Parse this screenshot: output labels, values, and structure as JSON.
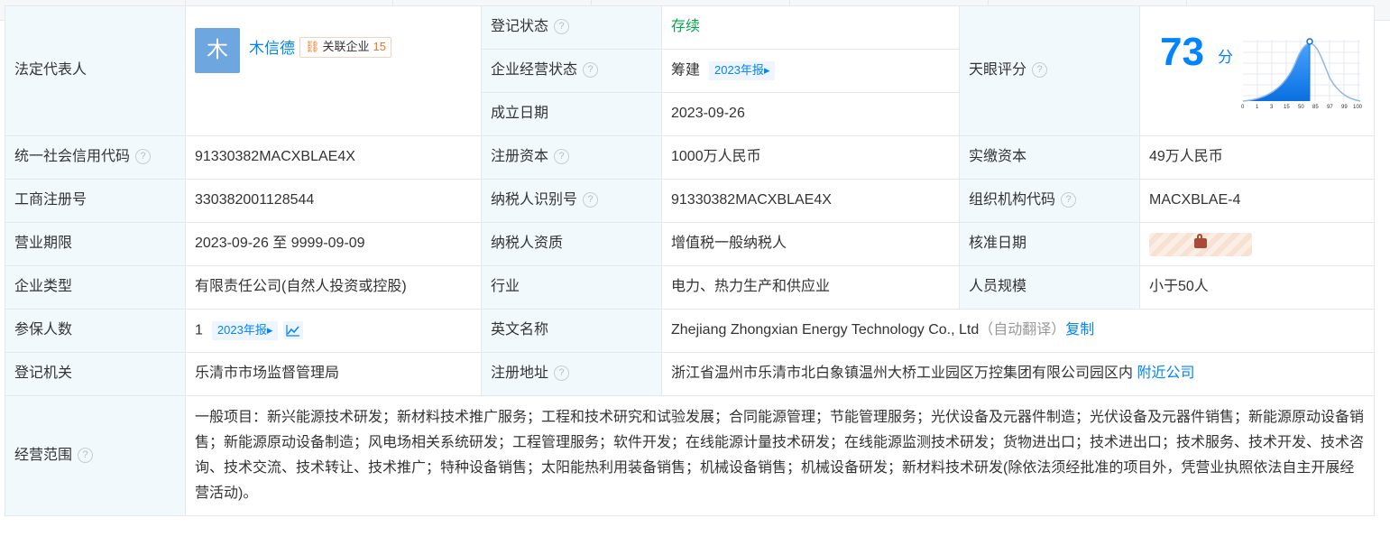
{
  "rep": {
    "label": "法定代表人",
    "avatar": "木",
    "name": "木信德",
    "related_label": "关联企业",
    "related_count": "15"
  },
  "status": {
    "label": "登记状态",
    "value": "存续"
  },
  "biz_status": {
    "label": "企业经营状态",
    "value": "筹建",
    "report": "2023年报"
  },
  "est_date": {
    "label": "成立日期",
    "value": "2023-09-26"
  },
  "rating": {
    "label": "天眼评分",
    "score": "73",
    "unit": "分",
    "axis": [
      "0",
      "1",
      "3",
      "15",
      "50",
      "85",
      "97",
      "99",
      "100"
    ],
    "marker_position": "50"
  },
  "credit_code": {
    "label": "统一社会信用代码",
    "value": "91330382MACXBLAE4X"
  },
  "reg_capital": {
    "label": "注册资本",
    "value": "1000万人民币"
  },
  "paid_capital": {
    "label": "实缴资本",
    "value": "49万人民币"
  },
  "reg_no": {
    "label": "工商注册号",
    "value": "330382001128544"
  },
  "taxpayer_id": {
    "label": "纳税人识别号",
    "value": "91330382MACXBLAE4X"
  },
  "org_code": {
    "label": "组织机构代码",
    "value": "MACXBLAE-4"
  },
  "term": {
    "label": "营业期限",
    "value": "2023-09-26 至 9999-09-09"
  },
  "taxpayer_qual": {
    "label": "纳税人资质",
    "value": "增值税一般纳税人"
  },
  "approve_date": {
    "label": "核准日期"
  },
  "type": {
    "label": "企业类型",
    "value": "有限责任公司(自然人投资或控股)"
  },
  "industry": {
    "label": "行业",
    "value": "电力、热力生产和供应业"
  },
  "staff": {
    "label": "人员规模",
    "value": "小于50人"
  },
  "insured": {
    "label": "参保人数",
    "value": "1",
    "report": "2023年报"
  },
  "english": {
    "label": "英文名称",
    "value": "Zhejiang Zhongxian Energy Technology Co., Ltd",
    "note": "（自动翻译）",
    "copy": "复制"
  },
  "authority": {
    "label": "登记机关",
    "value": "乐清市市场监督管理局"
  },
  "address": {
    "label": "注册地址",
    "value": "浙江省温州市乐清市北白象镇温州大桥工业园区万控集团有限公司园区内",
    "nearby": "附近公司"
  },
  "scope": {
    "label": "经营范围",
    "value": "一般项目：新兴能源技术研发；新材料技术推广服务；工程和技术研究和试验发展；合同能源管理；节能管理服务；光伏设备及元器件制造；光伏设备及元器件销售；新能源原动设备销售；新能源原动设备制造；风电场相关系统研发；工程管理服务；软件开发；在线能源计量技术研发；在线能源监测技术研发；货物进出口；技术进出口；技术服务、技术开发、技术咨询、技术交流、技术转让、技术推广；特种设备销售；太阳能热利用装备销售；机械设备销售；机械设备研发；新材料技术研发(除依法须经批准的项目外，凭营业执照依法自主开展经营活动)。"
  }
}
